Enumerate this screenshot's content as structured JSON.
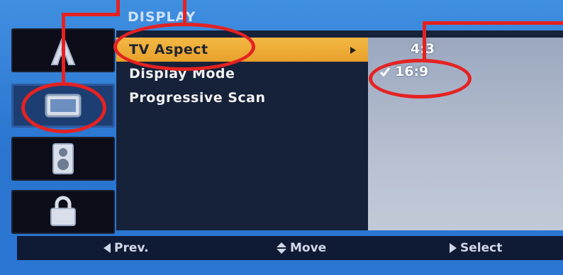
{
  "header": {
    "title": "DISPLAY"
  },
  "sidebar": {
    "tiles": [
      {
        "icon": "font-icon",
        "glyph": "A"
      },
      {
        "icon": "tv-icon"
      },
      {
        "icon": "speaker-icon"
      },
      {
        "icon": "lock-icon"
      }
    ]
  },
  "menu": {
    "items": [
      {
        "label": "TV Aspect"
      },
      {
        "label": "Display Mode"
      },
      {
        "label": "Progressive Scan"
      }
    ]
  },
  "options": {
    "opt1": "4:3",
    "opt2": "16:9"
  },
  "bottom_bar": {
    "prev": "Prev.",
    "move": "Move",
    "select": "Select"
  },
  "colors": {
    "accent": "#e7a12a",
    "annotation": "#e52222"
  }
}
